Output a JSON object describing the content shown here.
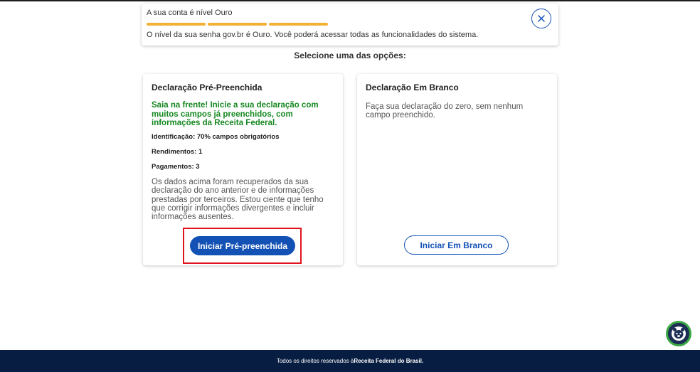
{
  "notification": {
    "title": "A sua conta é nível Ouro",
    "level_bars_filled": 3,
    "level_bars_total": 3,
    "level_color": "#f2b035",
    "description": "O nível da sua senha gov.br é Ouro. Você poderá acessar todas as funcionalidades do sistema.",
    "close_icon": "close-icon"
  },
  "section_heading": "Selecione uma das opções:",
  "cards": {
    "prefilled": {
      "title": "Declaração Pré-Preenchida",
      "highlight": "Saia na frente! Inicie a sua declaração com muitos campos já preenchidos, com informações da Receita Federal.",
      "stat_identification": "Identificação: 70% campos obrigatórios",
      "stat_income": "Rendimentos: 1",
      "stat_payments": "Pagamentos: 3",
      "body": "Os dados acima foram recuperados da sua declaração do ano anterior e de informações prestadas por terceiros. Estou ciente que tenho que corrigir informações divergentes e incluir informações ausentes.",
      "button_label": "Iniciar Pré-preenchida"
    },
    "blank": {
      "title": "Declaração Em Branco",
      "body": "Faça sua declaração do zero, sem nenhum campo preenchido.",
      "button_label": "Iniciar Em Branco"
    }
  },
  "assistant": {
    "icon": "assistant-avatar-icon"
  },
  "footer": {
    "text_prefix": "Todos os direitos reservados à ",
    "text_bold": "Receita Federal do Brasil."
  },
  "colors": {
    "primary": "#1351b4",
    "success": "#168821",
    "footer_bg": "#071d41",
    "highlight_border": "#e0141e"
  }
}
